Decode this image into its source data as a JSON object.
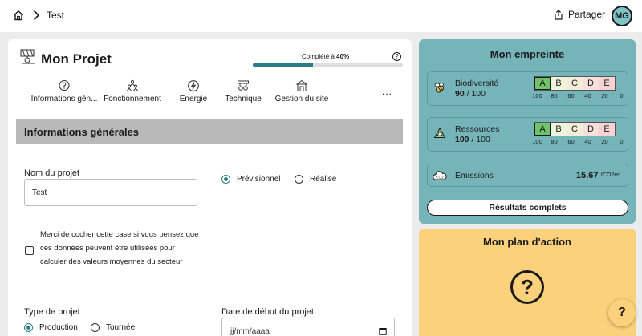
{
  "breadcrumb": {
    "item": "Test"
  },
  "header": {
    "share_label": "Partager",
    "avatar_initials": "MG"
  },
  "project": {
    "title": "Mon Projet",
    "progress_prefix": "Complété à ",
    "progress_value": "40%",
    "progress_fraction": 0.4
  },
  "tabs": [
    {
      "label": "Informations gén...",
      "icon": "question-bubble-icon"
    },
    {
      "label": "Fonctionnement",
      "icon": "people-icon"
    },
    {
      "label": "Energie",
      "icon": "energy-icon"
    },
    {
      "label": "Technique",
      "icon": "tools-icon"
    },
    {
      "label": "Gestion du site",
      "icon": "building-icon"
    }
  ],
  "more_label": "...",
  "section": {
    "title": "Informations générales"
  },
  "form": {
    "project_name_label": "Nom du projet",
    "project_name_value": "Test",
    "status_options": [
      {
        "label": "Prévisionnel",
        "selected": true
      },
      {
        "label": "Réalisé",
        "selected": false
      }
    ],
    "checkbox_text": "Merci de cocher cette case si vous pensez que ces données peuvent être utilisées pour calculer des valeurs moyennes du secteur",
    "project_type_label": "Type de projet",
    "type_options": [
      {
        "label": "Production",
        "selected": true
      },
      {
        "label": "Tournée",
        "selected": false
      }
    ],
    "start_date_label": "Date de début du projet",
    "start_date_placeholder": "jj/mm/aaaa"
  },
  "footprint": {
    "title": "Mon empreinte",
    "grade_letters": [
      "A",
      "B",
      "C",
      "D",
      "E"
    ],
    "grade_colors": [
      "#6fc36a",
      "#eef4d9",
      "#f3ecda",
      "#f6e1da",
      "#f6d3d3"
    ],
    "scale": [
      "100",
      "80",
      "60",
      "40",
      "20",
      "0"
    ],
    "biodiversity": {
      "name": "Biodiversité",
      "value": "90",
      "max": " / 100",
      "grade": "A"
    },
    "resources": {
      "name": "Ressources",
      "value": "100",
      "max": " / 100",
      "grade": "A"
    },
    "emissions": {
      "name": "Emissions",
      "value": "15.67",
      "unit": "tCO2eq"
    },
    "results_button": "Résultats complets"
  },
  "plan": {
    "title": "Mon plan d'action",
    "symbol": "?"
  },
  "help_fab": "?",
  "colors": {
    "accent": "#2a7e86",
    "footprint_bg": "#75b4b9",
    "plan_bg": "#fbd17b"
  }
}
